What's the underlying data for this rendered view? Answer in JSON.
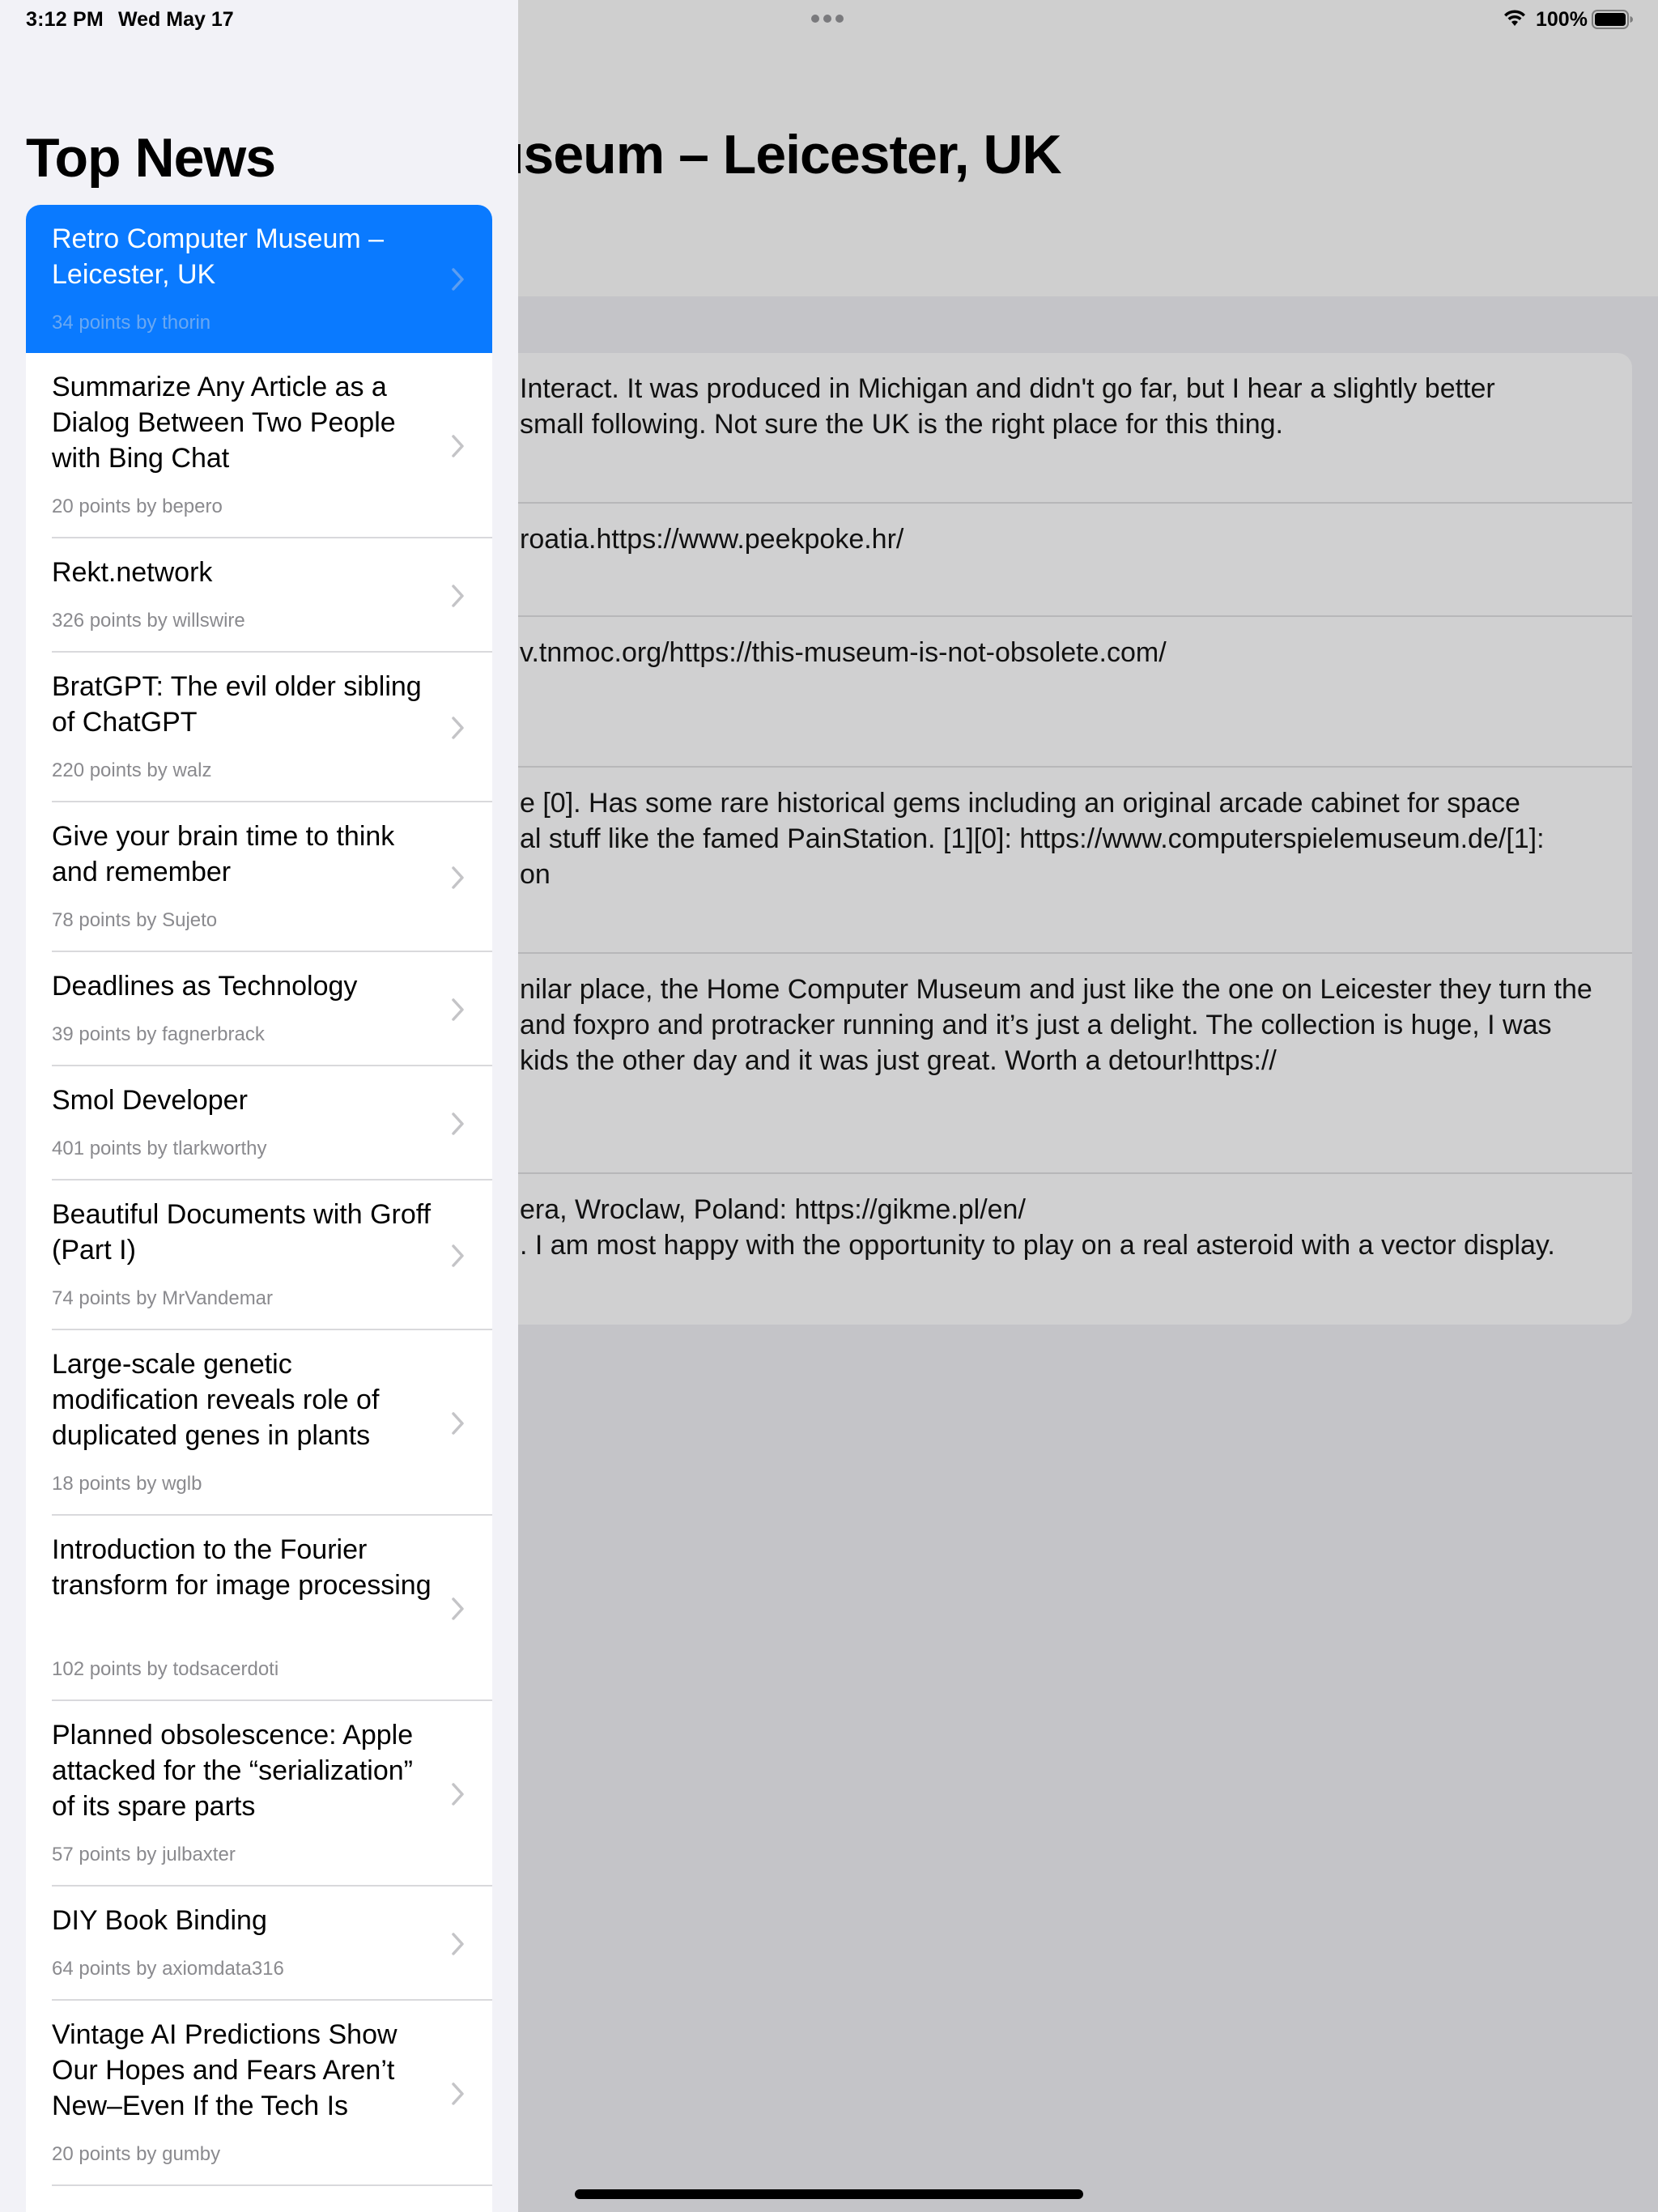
{
  "status_bar": {
    "time": "3:12 PM",
    "date": "Wed May 17",
    "battery": "100%"
  },
  "detail": {
    "title_visible": "useum – Leicester, UK",
    "comments": [
      {
        "lines": [
          "Interact. It was produced in Michigan and didn't go far, but I hear a slightly better",
          "small following. Not sure the UK is the right place for this thing."
        ]
      },
      {
        "lines": [
          "roatia.https://www.peekpoke.hr/"
        ]
      },
      {
        "lines": [
          "v.tnmoc.org/https://this-museum-is-not-obsolete.com/"
        ]
      },
      {
        "lines": [
          "e [0]. Has some rare historical gems including an original arcade cabinet for space",
          "al stuff like the famed PainStation. [1][0]: https://www.computerspielemuseum.de/[1]:",
          "on"
        ]
      },
      {
        "lines": [
          "nilar place, the Home Computer Museum and just like the one on Leicester they turn the",
          "and foxpro and protracker running and it’s just a delight. The collection is huge, I was",
          "kids the other day and it was just great. Worth a detour!https://"
        ]
      },
      {
        "lines": [
          "era, Wroclaw, Poland: https://gikme.pl/en/",
          ". I am most happy with the opportunity to play on a real asteroid with a vector display."
        ]
      }
    ]
  },
  "sidebar": {
    "title": "Top News",
    "items": [
      {
        "title": "Retro Computer Museum – Leicester, UK",
        "meta": "34 points by thorin",
        "selected": true
      },
      {
        "title": "Summarize Any Article as a Dialog Between Two People with Bing Chat",
        "meta": "20 points by bepero"
      },
      {
        "title": "Rekt.network",
        "meta": "326 points by willswire"
      },
      {
        "title": "BratGPT: The evil older sibling of ChatGPT",
        "meta": "220 points by walz"
      },
      {
        "title": "Give your brain time to think and remember",
        "meta": "78 points by Sujeto"
      },
      {
        "title": "Deadlines as Technology",
        "meta": "39 points by fagnerbrack"
      },
      {
        "title": "Smol Developer",
        "meta": "401 points by tlarkworthy"
      },
      {
        "title": "Beautiful Documents with Groff (Part I)",
        "meta": "74 points by MrVandemar"
      },
      {
        "title": "Large-scale genetic modification reveals role of duplicated genes in plants",
        "meta": "18 points by wglb"
      },
      {
        "title": "Introduction to the Fourier transform for image processing",
        "meta": "102 points by todsacerdoti"
      },
      {
        "title": "Planned obsolescence: Apple attacked for the “serialization” of its spare parts",
        "meta": "57 points by julbaxter"
      },
      {
        "title": "DIY Book Binding",
        "meta": "64 points by axiomdata316"
      },
      {
        "title": "Vintage AI Predictions Show Our Hopes and Fears Aren’t New–Even If the Tech Is",
        "meta": "20 points by gumby"
      },
      {
        "title": "",
        "meta": ""
      }
    ]
  }
}
